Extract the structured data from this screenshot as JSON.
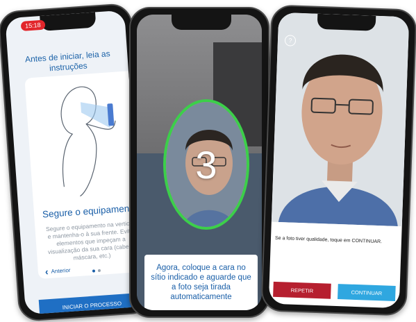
{
  "phone1": {
    "status_time": "15:18",
    "intro": "Antes de iniciar, leia as instruções",
    "card_title": "Segure o equipamento na",
    "card_body": "Segure o equipamento na vertical e mantenha-o à sua frente. Evite elementos que impeçam a visualização da sua cara (cabelo, máscara, etc.)",
    "prev_label": "Anterior",
    "start_button": "INICIAR O PROCESSO",
    "page_indicator": {
      "total": 2,
      "active": 1
    }
  },
  "phone2": {
    "countdown": "3",
    "instruction": "Agora, coloque a cara no sítio indicado e aguarde que a foto seja tirada automaticamente",
    "oval_color": "#3ccf4a"
  },
  "phone3": {
    "quality_text": "Se a foto tiver qualidade, toque em CONTINUAR.",
    "repeat_button": "REPETIR",
    "continue_button": "CONTINUAR",
    "repeat_color": "#b61f2f",
    "continue_color": "#2fa7e0",
    "help_icon": "help-icon"
  }
}
